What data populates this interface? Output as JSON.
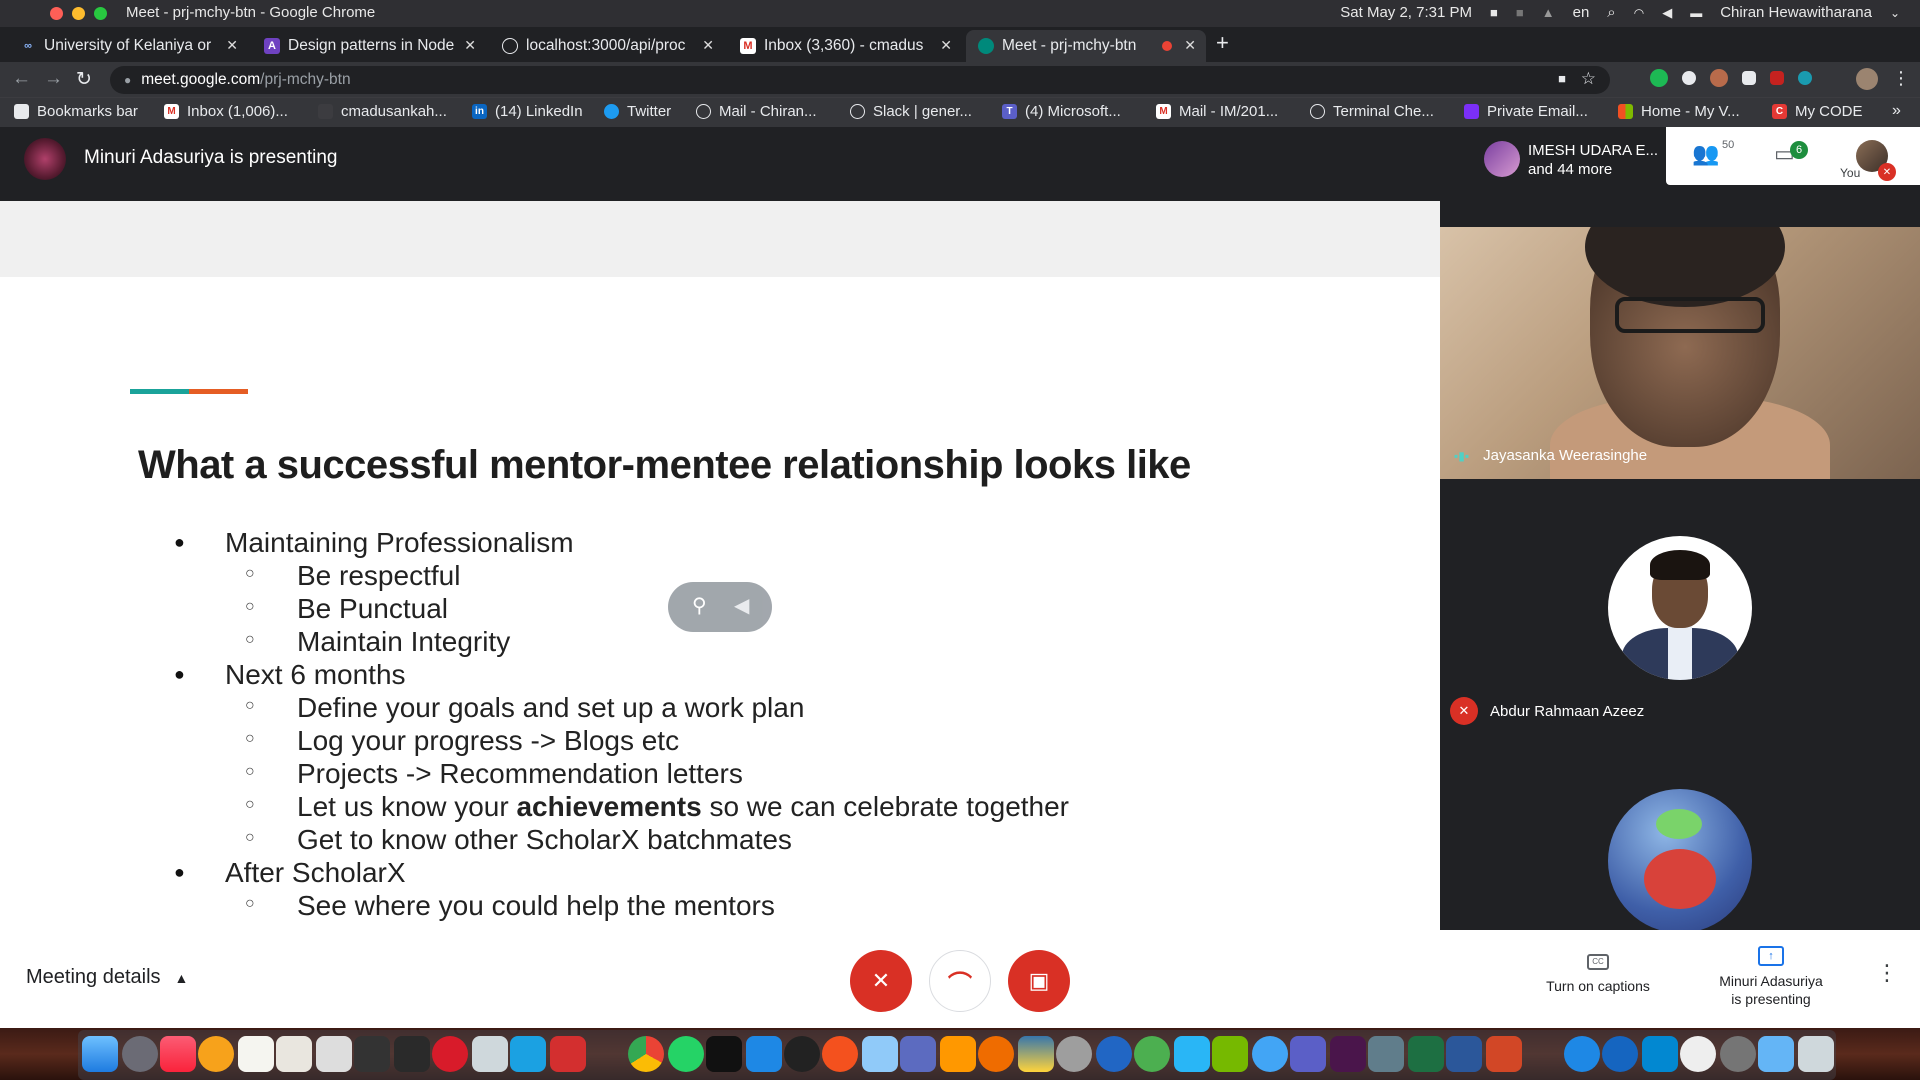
{
  "menubar": {
    "window_title": "Meet - prj-mchy-btn - Google Chrome",
    "lang": "en",
    "datetime": "Sat May  2,  7:31 PM",
    "user": "Chiran Hewawitharana"
  },
  "tabs": [
    {
      "title": "University of Kelaniya or",
      "icon": "cc-icon"
    },
    {
      "title": "Design patterns in Node",
      "icon": "app-icon"
    },
    {
      "title": "localhost:3000/api/proc",
      "icon": "globe-icon"
    },
    {
      "title": "Inbox (3,360) - cmadus",
      "icon": "gmail-icon"
    },
    {
      "title": "Meet - prj-mchy-btn",
      "icon": "meet-icon"
    }
  ],
  "omnibox": {
    "host": "meet.google.com",
    "path": "/prj-mchy-btn"
  },
  "bookmarks": [
    "Bookmarks bar",
    "Inbox (1,006)...",
    "cmadusankah...",
    "(14) LinkedIn",
    "Twitter",
    "Mail - Chiran...",
    "Slack | gener...",
    "(4) Microsoft...",
    "Mail - IM/201...",
    "Terminal Che...",
    "Private Email...",
    "Home - My V...",
    "My CODE"
  ],
  "meet": {
    "presenting_title": "Minuri Adasuriya is presenting",
    "people_name": "IMESH UDARA E...",
    "people_more": "and 44 more",
    "participants_count": "50",
    "chat_count": "6",
    "you_label": "You"
  },
  "slide": {
    "title": "What a successful mentor-mentee relationship looks like",
    "items": [
      {
        "level": 1,
        "text": "Maintaining Professionalism"
      },
      {
        "level": 2,
        "text": "Be respectful"
      },
      {
        "level": 2,
        "text": "Be Punctual"
      },
      {
        "level": 2,
        "text": "Maintain Integrity"
      },
      {
        "level": 1,
        "text": "Next 6 months"
      },
      {
        "level": 2,
        "text": "Define your goals and set up a work plan"
      },
      {
        "level": 2,
        "text": "Log your progress -> Blogs etc"
      },
      {
        "level": 2,
        "text": "Projects -> Recommendation letters"
      },
      {
        "level": 2,
        "text_before": "Let us know your ",
        "bold": "achievements",
        "text_after": " so we can celebrate together"
      },
      {
        "level": 2,
        "text": "Get to know other ScholarX batchmates"
      },
      {
        "level": 1,
        "text": "After ScholarX"
      },
      {
        "level": 2,
        "text": "See where you could help the mentors"
      }
    ]
  },
  "tiles": {
    "speaker_name": "Jayasanka Weerasinghe",
    "second_name": "Abdur Rahmaan Azeez"
  },
  "bottom": {
    "meeting_details": "Meeting details",
    "captions": "Turn on captions",
    "presenting_line1": "Minuri Adasuriya",
    "presenting_line2": "is presenting"
  },
  "colors": {
    "accent_teal": "#1aa39a",
    "accent_orange": "#e55d24",
    "danger_red": "#d93025",
    "meet_dark": "#202124"
  }
}
